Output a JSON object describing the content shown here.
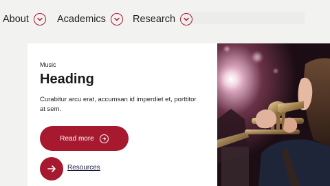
{
  "nav": {
    "items": [
      {
        "label": "About"
      },
      {
        "label": "Academics"
      },
      {
        "label": "Research"
      }
    ]
  },
  "card": {
    "eyebrow": "Music",
    "heading": "Heading",
    "body": "Curabitur arcu erat, accumsan id imperdiet et, porttitor at sem.",
    "primary_button": "Read more",
    "link_label": "Resources"
  },
  "icons": {
    "nav_toggle": "chevron-down-icon",
    "button": "arrow-right-circle-icon",
    "link": "arrow-right-icon"
  },
  "colors": {
    "brand": "#a6192e",
    "background": "#f2f2f1",
    "card": "#ffffff"
  }
}
